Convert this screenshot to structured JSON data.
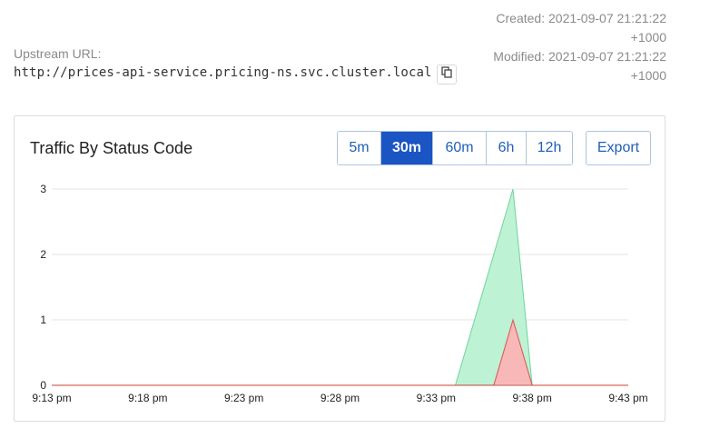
{
  "meta": {
    "created": "Created: 2021-09-07 21:21:22",
    "created_tz": "+1000",
    "modified": "Modified: 2021-09-07 21:21:22",
    "modified_tz": "+1000"
  },
  "upstream": {
    "label": "Upstream URL:",
    "url": "http://prices-api-service.pricing-ns.svc.cluster.local",
    "copy_icon": "copy-icon"
  },
  "panel": {
    "title": "Traffic By Status Code",
    "ranges": [
      "5m",
      "30m",
      "60m",
      "6h",
      "12h"
    ],
    "selected_range": "30m",
    "export_label": "Export"
  },
  "colors": {
    "primary": "#1b55c4",
    "series_ok_fill": "#bdf2d4",
    "series_ok_stroke": "#6fd59a",
    "series_err_fill": "#f8b8b8",
    "series_err_stroke": "#d9534f"
  },
  "chart_data": {
    "type": "area",
    "x": [
      "9:13 pm",
      "9:18 pm",
      "9:23 pm",
      "9:28 pm",
      "9:33 pm",
      "9:38 pm",
      "9:43 pm"
    ],
    "x_minutes": [
      0,
      5,
      10,
      15,
      20,
      25,
      30
    ],
    "ylim": [
      0,
      3
    ],
    "yticks": [
      0,
      1,
      2,
      3
    ],
    "grid": true,
    "series": [
      {
        "color": "#bdf2d4",
        "points": [
          [
            0,
            0
          ],
          [
            21,
            0
          ],
          [
            24,
            3
          ],
          [
            25,
            0
          ],
          [
            30,
            0
          ]
        ]
      },
      {
        "color": "#f8b8b8",
        "points": [
          [
            0,
            0
          ],
          [
            23,
            0
          ],
          [
            24,
            1
          ],
          [
            25,
            0
          ],
          [
            30,
            0
          ]
        ]
      }
    ]
  }
}
